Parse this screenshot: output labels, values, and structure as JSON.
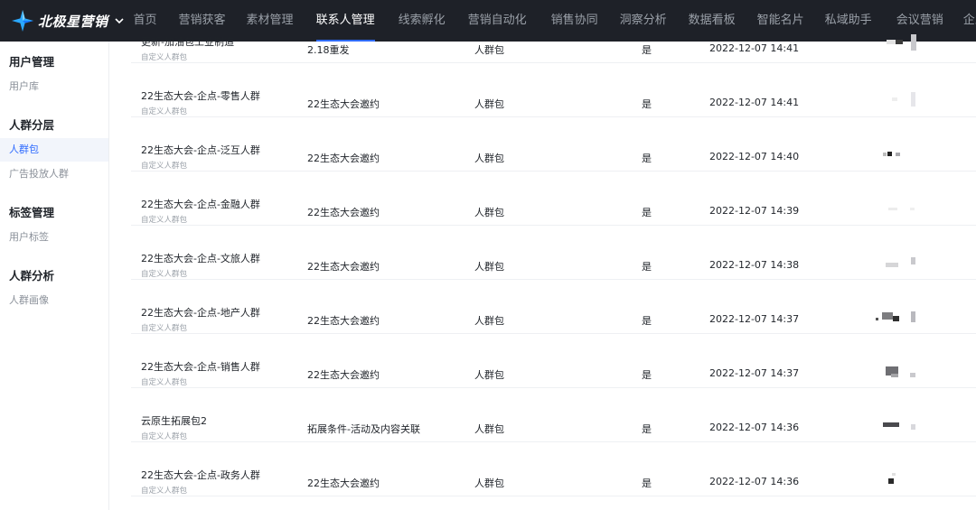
{
  "brand": {
    "name": "北极星营销"
  },
  "nav": {
    "items": [
      {
        "label": "首页",
        "active": false
      },
      {
        "label": "营销获客",
        "active": false
      },
      {
        "label": "素材管理",
        "active": false
      },
      {
        "label": "联系人管理",
        "active": true
      },
      {
        "label": "线索孵化",
        "active": false
      },
      {
        "label": "营销自动化",
        "active": false
      },
      {
        "label": "销售协同",
        "active": false
      },
      {
        "label": "洞察分析",
        "active": false
      },
      {
        "label": "数据看板",
        "active": false
      },
      {
        "label": "智能名片",
        "active": false
      },
      {
        "label": "私域助手",
        "active": false
      },
      {
        "label": "会议营销",
        "active": false
      },
      {
        "label": "企业",
        "active": false
      }
    ]
  },
  "sidebar": {
    "groups": [
      {
        "title": "用户管理",
        "items": [
          {
            "label": "用户库",
            "active": false
          }
        ]
      },
      {
        "title": "人群分层",
        "items": [
          {
            "label": "人群包",
            "active": true
          },
          {
            "label": "广告投放人群",
            "active": false
          }
        ]
      },
      {
        "title": "标签管理",
        "items": [
          {
            "label": "用户标签",
            "active": false
          }
        ]
      },
      {
        "title": "人群分析",
        "items": [
          {
            "label": "人群画像",
            "active": false
          }
        ]
      }
    ]
  },
  "table": {
    "rows": [
      {
        "name": "更新-加油包工业制造",
        "sub": "自定义人群包",
        "source": "2.18重发",
        "type": "人群包",
        "flag": "是",
        "time": "2022-12-07 14:41"
      },
      {
        "name": "22生态大会-企点-零售人群",
        "sub": "自定义人群包",
        "source": "22生态大会邀约",
        "type": "人群包",
        "flag": "是",
        "time": "2022-12-07 14:41"
      },
      {
        "name": "22生态大会-企点-泛互人群",
        "sub": "自定义人群包",
        "source": "22生态大会邀约",
        "type": "人群包",
        "flag": "是",
        "time": "2022-12-07 14:40"
      },
      {
        "name": "22生态大会-企点-金融人群",
        "sub": "自定义人群包",
        "source": "22生态大会邀约",
        "type": "人群包",
        "flag": "是",
        "time": "2022-12-07 14:39"
      },
      {
        "name": "22生态大会-企点-文旅人群",
        "sub": "自定义人群包",
        "source": "22生态大会邀约",
        "type": "人群包",
        "flag": "是",
        "time": "2022-12-07 14:38"
      },
      {
        "name": "22生态大会-企点-地产人群",
        "sub": "自定义人群包",
        "source": "22生态大会邀约",
        "type": "人群包",
        "flag": "是",
        "time": "2022-12-07 14:37"
      },
      {
        "name": "22生态大会-企点-销售人群",
        "sub": "自定义人群包",
        "source": "22生态大会邀约",
        "type": "人群包",
        "flag": "是",
        "time": "2022-12-07 14:37"
      },
      {
        "name": "云原生拓展包2",
        "sub": "自定义人群包",
        "source": "拓展条件-活动及内容关联",
        "type": "人群包",
        "flag": "是",
        "time": "2022-12-07 14:36"
      },
      {
        "name": "22生态大会-企点-政务人群",
        "sub": "自定义人群包",
        "source": "22生态大会邀约",
        "type": "人群包",
        "flag": "是",
        "time": "2022-12-07 14:36"
      }
    ]
  },
  "colors": {
    "topbar": "#1e2128",
    "accent": "#2f6bff",
    "text": "#1f2329",
    "muted": "#9aa0a8"
  },
  "icons": {
    "brand_logo": "star-logo-icon",
    "brand_switch": "chevron-down-icon"
  }
}
